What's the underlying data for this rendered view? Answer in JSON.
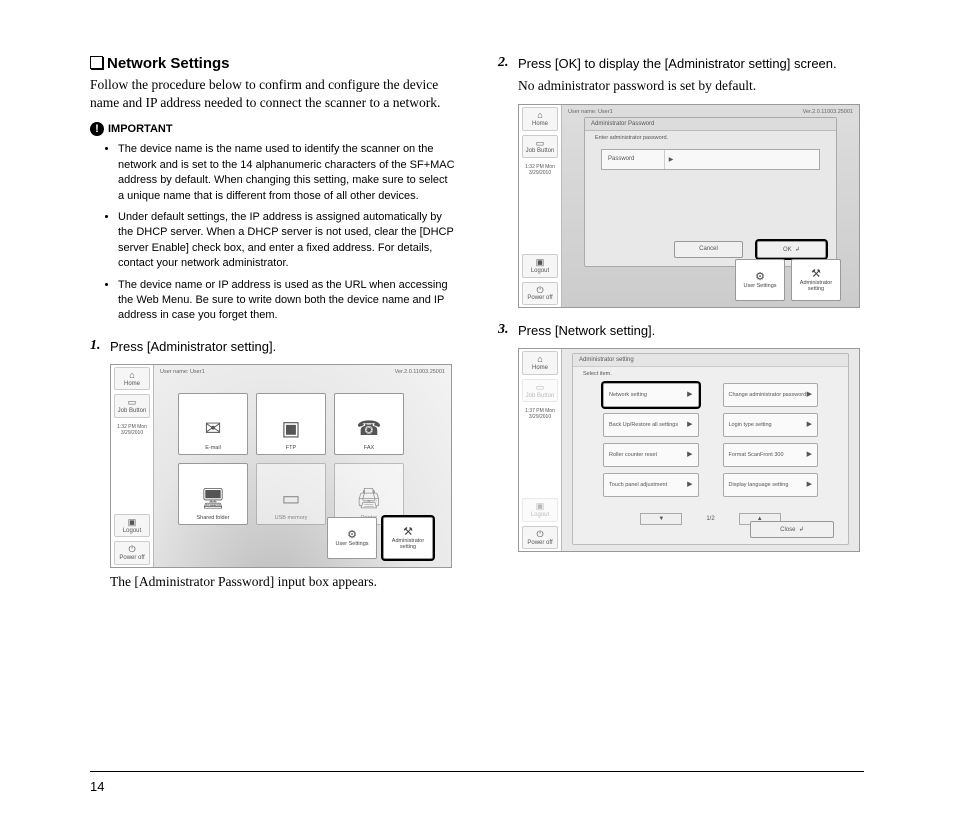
{
  "section": {
    "title": "Network Settings"
  },
  "intro": "Follow the procedure below to confirm and configure the device name and IP address needed to connect the scanner to a network.",
  "important": {
    "label": "IMPORTANT",
    "notes": [
      "The device name is the name used to identify the scanner on the network and is set to the 14 alphanumeric characters of the SF+MAC address by default. When changing this setting, make sure to select a unique name that is different from those of all other devices.",
      "Under default settings, the IP address is assigned automatically by the DHCP server. When a DHCP server is not used, clear the [DHCP server Enable] check box, and enter a fixed address. For details, contact your network administrator.",
      "The device name or IP address is used as the URL when accessing the Web Menu. Be sure to write down both the device name and IP address in case you forget them."
    ]
  },
  "steps": {
    "s1": {
      "num": "1.",
      "text": "Press [Administrator setting].",
      "after": "The [Administrator Password] input box appears."
    },
    "s2": {
      "num": "2.",
      "text": "Press [OK] to display the [Administrator setting] screen.",
      "sub": "No administrator password is set by default."
    },
    "s3": {
      "num": "3.",
      "text": "Press [Network setting]."
    }
  },
  "shot_shared": {
    "user": "User name: User1",
    "ver": "Ver.2.0.11003.25001",
    "time1": "1:32 PM  Mon",
    "date1": "3/29/2010",
    "time2": "1:37 PM  Mon",
    "date2": "3/29/2010",
    "sb": {
      "home": "Home",
      "job": "Job Button",
      "logout": "Logout",
      "power": "Power off"
    }
  },
  "shot1": {
    "tiles": {
      "email": "E-mail",
      "ftp": "FTP",
      "fax": "FAX",
      "shared": "Shared folder",
      "usb": "USB memory",
      "printer": "Printer"
    },
    "usersettings": "User Settings",
    "adminsetting": "Administrator setting"
  },
  "shot2": {
    "modal_title": "Administrator Password",
    "modal_sub": "Enter administrator password.",
    "pw_label": "Password",
    "cancel": "Cancel",
    "ok": "OK",
    "usersettings": "User Settings",
    "adminsetting": "Administrator setting"
  },
  "shot3": {
    "title": "Administrator setting",
    "select": "Select item.",
    "items": {
      "net": "Network setting",
      "chpw": "Change administrator password",
      "backup": "Back Up/Restore all settings",
      "login": "Login type setting",
      "roller": "Roller counter reset",
      "format": "Format ScanFront 300",
      "touch": "Touch panel adjustment",
      "lang": "Display language setting"
    },
    "page": "1/2",
    "close": "Close"
  },
  "pageNumber": "14"
}
